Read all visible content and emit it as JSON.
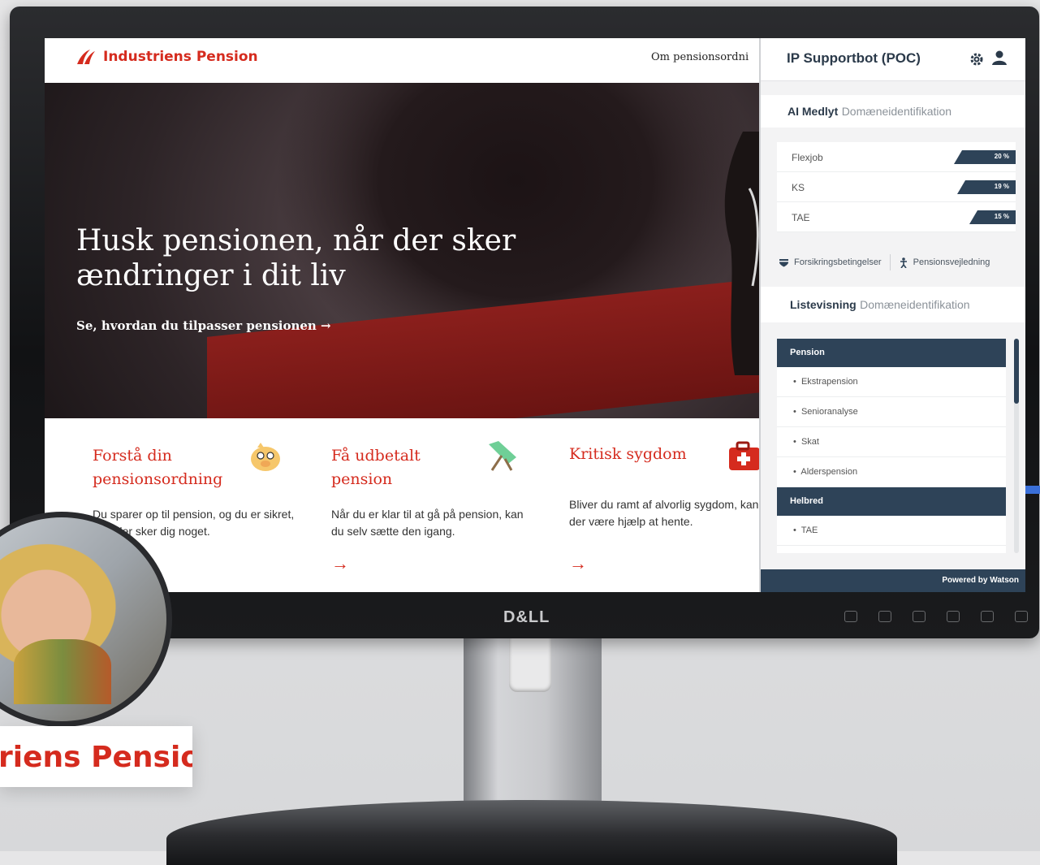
{
  "monitor": {
    "brand": "D&LL"
  },
  "site": {
    "brand": "Industriens Pension",
    "nav": {
      "item1": "Om pensionsordni"
    },
    "hero": {
      "title": "Husk pensionen, når der sker ændringer i dit liv",
      "link": "Se, hvordan du tilpasser pensionen →"
    },
    "cards": [
      {
        "title": "Forstå din pensionsordning",
        "body": "Du sparer op til pension, og du er sikret, hvis der sker dig noget.",
        "arrow": "→",
        "icon": "piggy-bank-icon"
      },
      {
        "title": "Få udbetalt pension",
        "body": "Når du er klar til at gå på pension, kan du selv sætte den igang.",
        "arrow": "→",
        "icon": "deck-chair-icon"
      },
      {
        "title": "Kritisk sygdom",
        "body": "Bliver du ramt af alvorlig sygdom, kan der være hjælp at hente.",
        "arrow": "→",
        "icon": "first-aid-kit-icon"
      }
    ]
  },
  "chatbot": {
    "title": "IP Supportbot (POC)",
    "ai": {
      "bold": "AI Medlyt",
      "light": "Domæneidentifikation"
    },
    "scores": [
      {
        "name": "Flexjob",
        "value": 0.2,
        "label": "20 %"
      },
      {
        "name": "KS",
        "value": 0.19,
        "label": "19 %"
      },
      {
        "name": "TAE",
        "value": 0.15,
        "label": "15 %"
      }
    ],
    "tabs": {
      "tab1": "Forsikringsbetingelser",
      "tab2": "Pensionsvejledning"
    },
    "list_header": {
      "bold": "Listevisning",
      "light": "Domæneidentifikation"
    },
    "list": {
      "cat1": "Pension",
      "items1": [
        "Ekstrapension",
        "Senioranalyse",
        "Skat",
        "Alderspension"
      ],
      "cat2": "Helbred",
      "items2": [
        "TAE"
      ]
    },
    "footer": "Powered by Watson"
  },
  "overlay": {
    "logo_text": "riens Pension"
  },
  "colors": {
    "brand_red": "#d52b1e",
    "bot_navy": "#2e4358"
  }
}
